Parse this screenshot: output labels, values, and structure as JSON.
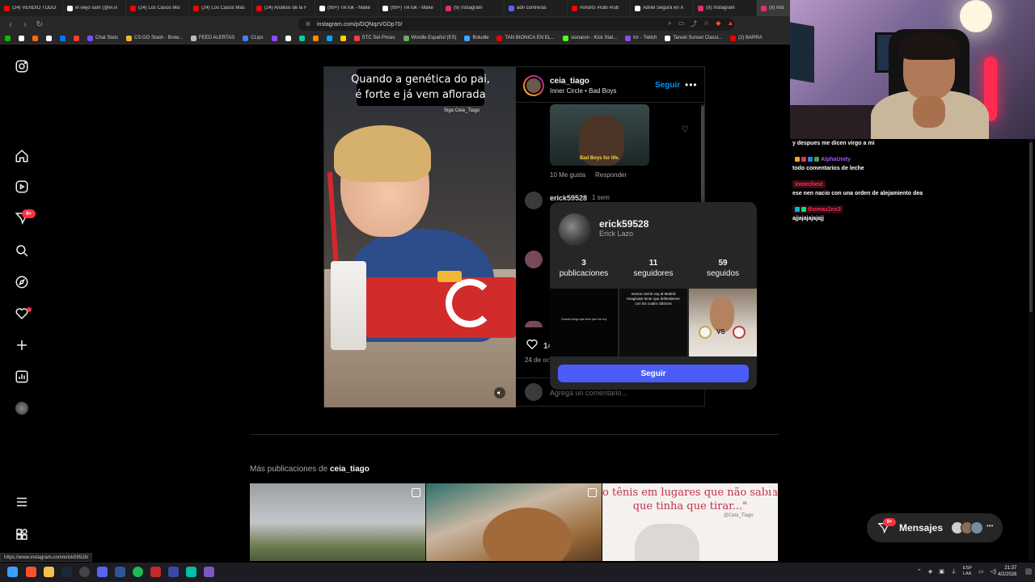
{
  "browser": {
    "tabs": [
      {
        "title": "(24) VENDIÓ TODO",
        "color": "#ff0000"
      },
      {
        "title": "el viejo sam (@el.vi",
        "color": "#ffffff"
      },
      {
        "title": "(24) Los Casos Mis",
        "color": "#ff0000"
      },
      {
        "title": "(24) Los Casos Más",
        "color": "#ff0000"
      },
      {
        "title": "(24) Análisis de la F",
        "color": "#ff0000"
      },
      {
        "title": "(99+) TikTok - Make",
        "color": "#ffffff"
      },
      {
        "title": "(99+) TikTok - Make",
        "color": "#ffffff"
      },
      {
        "title": "(9) Instagram",
        "color": "#e1306c"
      },
      {
        "title": "adri contreras",
        "color": "#5865f2"
      },
      {
        "title": "#shorts #rubi #rub",
        "color": "#ff0000"
      },
      {
        "title": "Adriel Segura en X",
        "color": "#ffffff"
      },
      {
        "title": "(9) Instagram",
        "color": "#e1306c"
      },
      {
        "title": "(9) Inst",
        "color": "#e1306c",
        "active": true
      }
    ],
    "url": "instagram.com/p/DQNqzVGDp70/",
    "bookmarks": [
      {
        "label": "",
        "color": "#00c000"
      },
      {
        "label": "",
        "color": "#ffffff"
      },
      {
        "label": "",
        "color": "#ff6a00"
      },
      {
        "label": "",
        "color": "#ffffff"
      },
      {
        "label": "",
        "color": "#0077ff"
      },
      {
        "label": "",
        "color": "#ff3b30"
      },
      {
        "label": "Chat Stats",
        "color": "#7c4dff"
      },
      {
        "label": "CS:GO Stash - Brow...",
        "color": "#f2b632"
      },
      {
        "label": "FEED ALERTAS",
        "color": "#bbbbbb"
      },
      {
        "label": "CLips",
        "color": "#3b82f6"
      },
      {
        "label": "",
        "color": "#9146ff"
      },
      {
        "label": "",
        "color": "#ffffff"
      },
      {
        "label": "",
        "color": "#00d2a0"
      },
      {
        "label": "",
        "color": "#ff8a00"
      },
      {
        "label": "",
        "color": "#00aaff"
      },
      {
        "label": "",
        "color": "#ffd400"
      },
      {
        "label": "STC Set Prices",
        "color": "#ff3b3b"
      },
      {
        "label": "Wordle Español (ES)",
        "color": "#6aaa64"
      },
      {
        "label": "Boludle",
        "color": "#3ea6ff"
      },
      {
        "label": "TAN BIONICA EN EL...",
        "color": "#e00"
      },
      {
        "label": "sionaron - Kick Stat...",
        "color": "#53fc18"
      },
      {
        "label": "tnr - Twitch",
        "color": "#9146ff"
      },
      {
        "label": "Tanuki Sunset Classi...",
        "color": "#ffffff"
      },
      {
        "label": "(2) BARRA",
        "color": "#e00"
      }
    ]
  },
  "post": {
    "caption_lines": [
      "Quando a genética do pai,",
      "é forte e já vem aflorada"
    ],
    "watermark": "Siga Ceia_Tiago",
    "username": "ceia_tiago",
    "audio": "Inner Circle • Bad Boys",
    "follow_label": "Seguir",
    "more_label": "•••",
    "gif_text": "Bad Boys for life.",
    "comment_likes": "10 Me gusta",
    "reply_label": "Responder",
    "commenter": "erick59528",
    "comment_time": "1 sem",
    "likes_count": "14",
    "date": "24 de oc",
    "add_comment_placeholder": "Agrega un comentario..."
  },
  "hover_card": {
    "username": "erick59528",
    "full_name": "Erick Lazo",
    "stats": [
      {
        "value": "3",
        "label": "publicaciones"
      },
      {
        "value": "11",
        "label": "seguidores"
      },
      {
        "value": "59",
        "label": "seguidos"
      }
    ],
    "thumb1_text": "Cuando tengo que decir que me voy",
    "thumb2_text": "menos mal le voy al Madrid Imagínate tener que defenderme con los cuatro clásicos",
    "thumb3_vs": "VS",
    "follow_label": "Seguir"
  },
  "more_posts": {
    "prefix": "Más publicaciones de",
    "username": "ceia_tiago",
    "thumb3_text": "o tênis em lugares que não sabia que tinha que tirar...\"",
    "thumb3_sig": "@Ceia_Tiago"
  },
  "messages": {
    "label": "Mensajes",
    "badge": "9+",
    "more": "•••"
  },
  "rail": {
    "reels_badge": "9+"
  },
  "status_url": "https://www.instagram.com/erick59528/",
  "chat": [
    {
      "type": "text",
      "text": "y despues me dicen virgo a mi"
    },
    {
      "type": "user",
      "text": "AlphaUnity",
      "color": "#a855f7"
    },
    {
      "type": "text",
      "text": "todo comentarios de leche"
    },
    {
      "type": "user",
      "text": "inmechest",
      "color": "#ff2d55"
    },
    {
      "type": "text",
      "text": "ese nen nacio con una orden de alejamiento dea"
    },
    {
      "type": "user",
      "text": "thomas1nx3",
      "color": "#ff2d55"
    },
    {
      "type": "text",
      "text": "ajjajajajajajj"
    }
  ],
  "taskbar": {
    "lang_top": "ESP",
    "lang_bottom": "LAA",
    "time": "21:37",
    "date": "4/2/2026"
  }
}
